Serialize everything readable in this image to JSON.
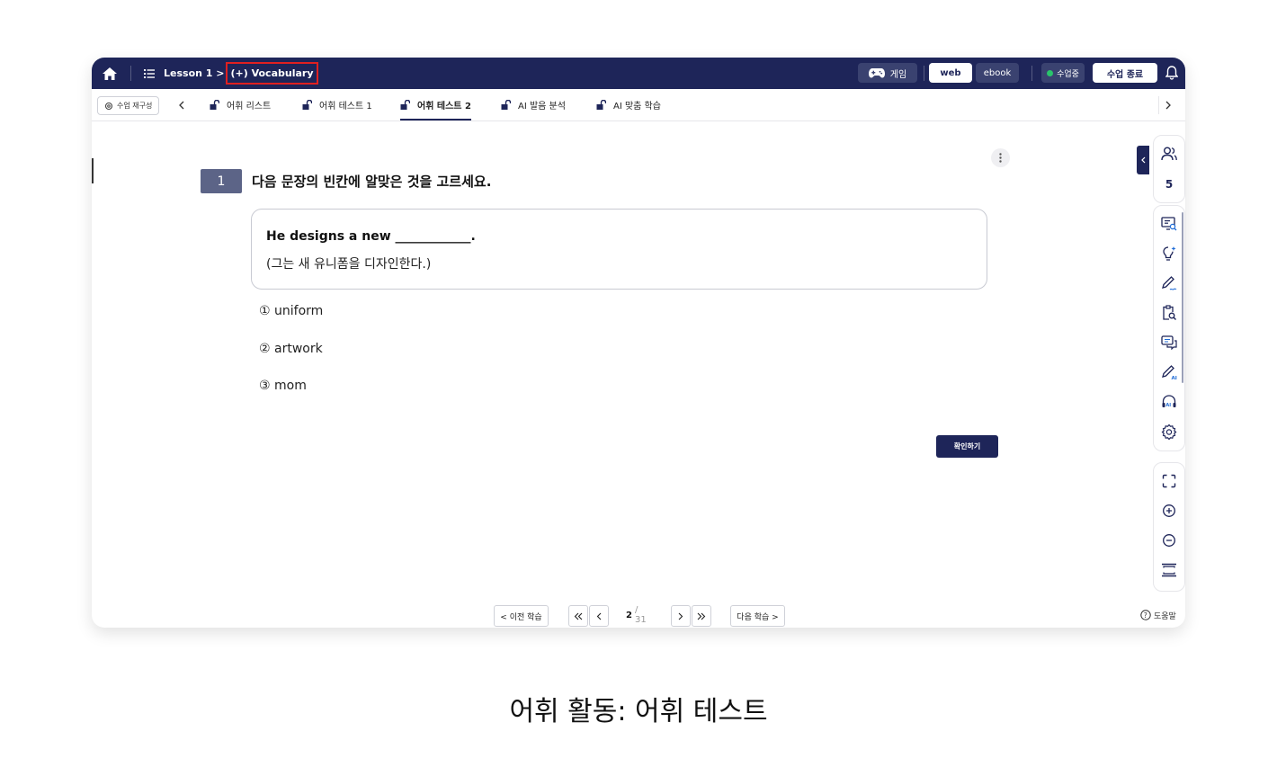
{
  "topbar": {
    "breadcrumb_lesson": "Lesson 1 >",
    "breadcrumb_current": "(+) Vocabulary",
    "game_label": "게임",
    "web_label": "web",
    "ebook_label": "ebook",
    "live_label": "수업중",
    "end_label": "수업 종료",
    "colors": {
      "bar": "#1e2559",
      "live_dot": "#29c46b",
      "highlight": "#e02020"
    }
  },
  "tabs": {
    "reset_label": "수업 재구성",
    "items": [
      {
        "label": "어휘 리스트"
      },
      {
        "label": "어휘 테스트 1"
      },
      {
        "label": "어휘 테스트 2"
      },
      {
        "label": "AI 발음 분석"
      },
      {
        "label": "AI 맞춤 학습"
      }
    ],
    "active_index": 2
  },
  "question": {
    "number": "1",
    "instruction": "다음 문장의 빈칸에 알맞은 것을 고르세요.",
    "sentence_en": "He designs a new ____________.",
    "sentence_ko": "(그는 새 유니폼을 디자인한다.)",
    "options": [
      {
        "marker": "①",
        "text": "uniform"
      },
      {
        "marker": "②",
        "text": "artwork"
      },
      {
        "marker": "③",
        "text": "mom"
      }
    ],
    "confirm_label": "확인하기"
  },
  "sidebar": {
    "participant_count": "5",
    "icons": [
      "users-icon",
      "screen-search-icon",
      "lightbulb-icon",
      "pen-icon",
      "clipboard-search-icon",
      "chat-icon",
      "ai-pen-icon",
      "ai-headset-icon",
      "settings-icon",
      "fullscreen-icon",
      "zoom-in-icon",
      "zoom-out-icon",
      "fit-height-icon"
    ],
    "help_label": "도움말"
  },
  "pager": {
    "prev_label": "< 이전 학습",
    "next_label": "다음 학습 >",
    "current": "2",
    "total": "/ 31"
  },
  "caption": "어휘 활동: 어휘 테스트"
}
